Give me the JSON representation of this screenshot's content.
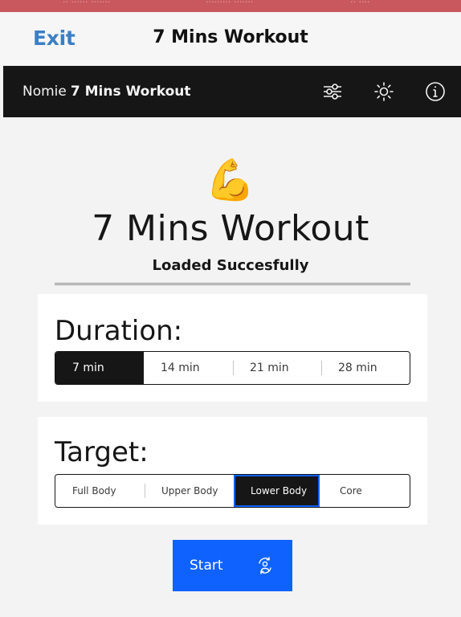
{
  "statusbar": {
    "blurred_text": "... 7 Mins Workout ...",
    "color": "#c9585e"
  },
  "navbar": {
    "exit_label": "Exit",
    "title": "7 Mins Workout",
    "exit_color": "#3b7fc4"
  },
  "header": {
    "brand_prefix": "Nomie",
    "brand_name": "7 Mins Workout",
    "icons": [
      "settings-sliders-icon",
      "brightness-icon",
      "info-icon"
    ]
  },
  "hero": {
    "emoji": "💪",
    "title": "7 Mins Workout",
    "subtitle": "Loaded Succesfully"
  },
  "duration": {
    "label": "Duration:",
    "options": [
      "7 min",
      "14 min",
      "21 min",
      "28 min"
    ],
    "selected": "7 min"
  },
  "target": {
    "label": "Target:",
    "options": [
      "Full Body",
      "Upper Body",
      "Lower Body",
      "Core"
    ],
    "selected": "Lower Body"
  },
  "start": {
    "label": "Start",
    "icon": "user-refresh-icon",
    "color": "#0f62fe"
  }
}
